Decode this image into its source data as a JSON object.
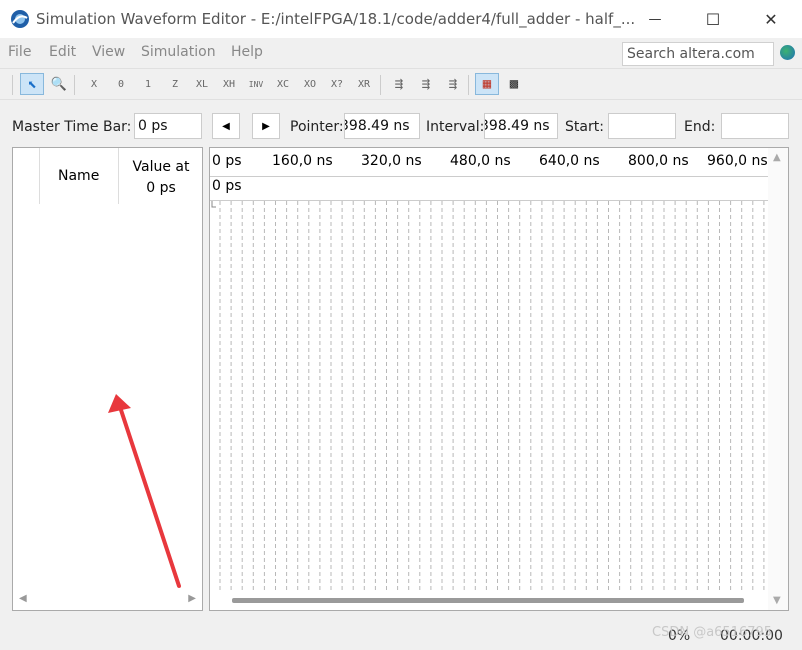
{
  "window": {
    "title": "Simulation Waveform Editor - E:/intelFPGA/18.1/code/adder4/full_adder - half_...",
    "minimize_glyph": "—",
    "maximize_glyph": "☐",
    "close_glyph": "✕"
  },
  "menu": [
    "File",
    "Edit",
    "View",
    "Simulation",
    "Help"
  ],
  "search": {
    "value": "Search altera.com"
  },
  "toolbar": {
    "items": [
      {
        "name": "selection-tool",
        "glyph": "⬉"
      },
      {
        "name": "zoom-tool",
        "glyph": "🔍"
      },
      {
        "name": "force-unknown",
        "glyph": "X"
      },
      {
        "name": "force-low",
        "glyph": "0"
      },
      {
        "name": "force-high",
        "glyph": "1"
      },
      {
        "name": "force-high-z",
        "glyph": "Z"
      },
      {
        "name": "force-weak-low",
        "glyph": "XL"
      },
      {
        "name": "force-weak-high",
        "glyph": "XH"
      },
      {
        "name": "invert",
        "glyph": "INV"
      },
      {
        "name": "count-value",
        "glyph": "XC"
      },
      {
        "name": "overwrite-clock",
        "glyph": "XO"
      },
      {
        "name": "arbitrary-value",
        "glyph": "X?"
      },
      {
        "name": "random-value",
        "glyph": "XR"
      },
      {
        "name": "run-functional-sim",
        "glyph": "⇶"
      },
      {
        "name": "run-timing-sim",
        "glyph": "⇶"
      },
      {
        "name": "generate-netlist",
        "glyph": "⇶"
      },
      {
        "name": "snap-to-grid",
        "glyph": "▦"
      },
      {
        "name": "grid-settings",
        "glyph": "▩"
      }
    ]
  },
  "timebar": {
    "master_label": "Master Time Bar:",
    "master_value": "0 ps",
    "prev_glyph": "◀",
    "next_glyph": "▶",
    "pointer_label": "Pointer:",
    "pointer_value": "398.49 ns",
    "interval_label": "Interval:",
    "interval_value": "398.49 ns",
    "start_label": "Start:",
    "start_value": "",
    "end_label": "End:",
    "end_value": ""
  },
  "signal_table": {
    "name_header": "Name",
    "value_header_line1": "Value at",
    "value_header_line2": "0 ps",
    "scroll_left_glyph": "◀",
    "scroll_right_glyph": "▶"
  },
  "waveform": {
    "ruler_ticks": [
      "0 ps",
      "160,0 ns",
      "320,0 ns",
      "480,0 ns",
      "640,0 ns",
      "800,0 ns",
      "960,0 ns"
    ],
    "cursor_label": "0 ps",
    "scroll_up_glyph": "▲",
    "scroll_down_glyph": "▼"
  },
  "status": {
    "progress": "0%",
    "elapsed": "00:00:00"
  },
  "watermark": "CSDN @a6516795",
  "colors": {
    "annotation_arrow": "#e8383d",
    "active_tool_bg": "#cce4f7",
    "grid_line": "#b8b8b8"
  }
}
